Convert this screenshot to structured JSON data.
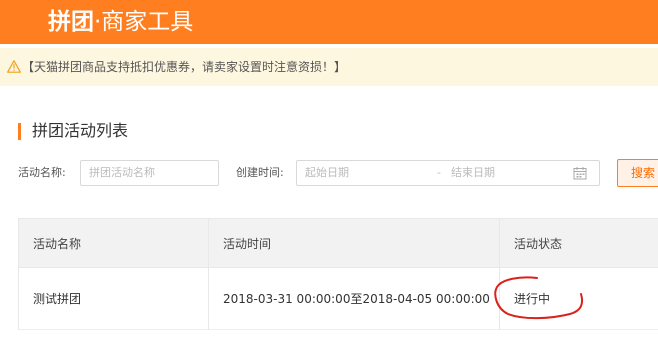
{
  "header": {
    "brand_strong": "拼团",
    "brand_sub": "·商家工具"
  },
  "notice": {
    "icon": "warning-triangle-icon",
    "text": "【天猫拼团商品支持抵扣优惠券，请卖家设置时注意资损！】"
  },
  "section": {
    "title": "拼团活动列表"
  },
  "filters": {
    "name_label": "活动名称:",
    "name_placeholder": "拼团活动名称",
    "time_label": "创建时间:",
    "start_placeholder": "起始日期",
    "separator": "-",
    "end_placeholder": "结束日期",
    "calendar_icon": "calendar-icon",
    "search_label": "搜索"
  },
  "table": {
    "columns": [
      "活动名称",
      "活动时间",
      "活动状态"
    ],
    "rows": [
      {
        "name": "测试拼团",
        "time": "2018-03-31 00:00:00至2018-04-05 00:00:00",
        "status": "进行中"
      }
    ]
  },
  "colors": {
    "brand_orange": "#ff7e1f",
    "notice_bg": "#fef7e0",
    "annotation_red": "#d9221c"
  }
}
